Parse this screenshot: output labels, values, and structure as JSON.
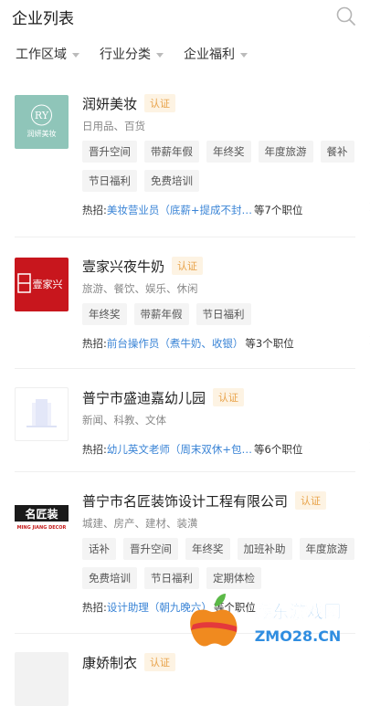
{
  "header": {
    "title": "企业列表"
  },
  "filters": [
    {
      "label": "工作区域"
    },
    {
      "label": "行业分类"
    },
    {
      "label": "企业福利"
    }
  ],
  "companies": [
    {
      "name": "润妍美妆",
      "verify": "认证",
      "industry": "日用品、百货",
      "logo_text": "RY",
      "logo_caption": "润妍美妆",
      "tags": [
        "晋升空间",
        "带薪年假",
        "年终奖",
        "年度旅游",
        "餐补",
        "节日福利",
        "免费培训"
      ],
      "hot_label": "热招:",
      "hot_job": "美妆营业员（底薪+提成不封…",
      "hot_count": "等7个职位"
    },
    {
      "name": "壹家兴夜牛奶",
      "verify": "认证",
      "industry": "旅游、餐饮、娱乐、休闲",
      "logo_text": "壹家兴",
      "tags": [
        "年终奖",
        "带薪年假",
        "节日福利"
      ],
      "hot_label": "热招:",
      "hot_job": "前台操作员（煮牛奶、收银）",
      "hot_count": "等3个职位"
    },
    {
      "name": "普宁市盛迪嘉幼儿园",
      "verify": "认证",
      "industry": "新闻、科教、文体",
      "tags": [],
      "hot_label": "热招:",
      "hot_job": "幼儿英文老师（周末双休+包…",
      "hot_count": "等6个职位"
    },
    {
      "name": "普宁市名匠装饰设计工程有限公司",
      "verify": "认证",
      "industry": "城建、房产、建材、装潢",
      "logo_text": "名匠装",
      "logo_sub": "MING JIANG DECOR",
      "tags": [
        "话补",
        "晋升空间",
        "年终奖",
        "加班补助",
        "年度旅游",
        "免费培训",
        "节日福利",
        "定期体检"
      ],
      "hot_label": "热招:",
      "hot_job": "设计助理（朝九晚六）",
      "hot_count": "等个职位"
    },
    {
      "name": "康娇制衣",
      "verify": "认证"
    }
  ],
  "watermark": {
    "line1": "猴东游戏网",
    "line2": "ZMO28.CN"
  },
  "colors": {
    "accent_blue": "#3a84d6",
    "verify_orange": "#e8a248",
    "tag_bg": "#f4f4f4"
  }
}
